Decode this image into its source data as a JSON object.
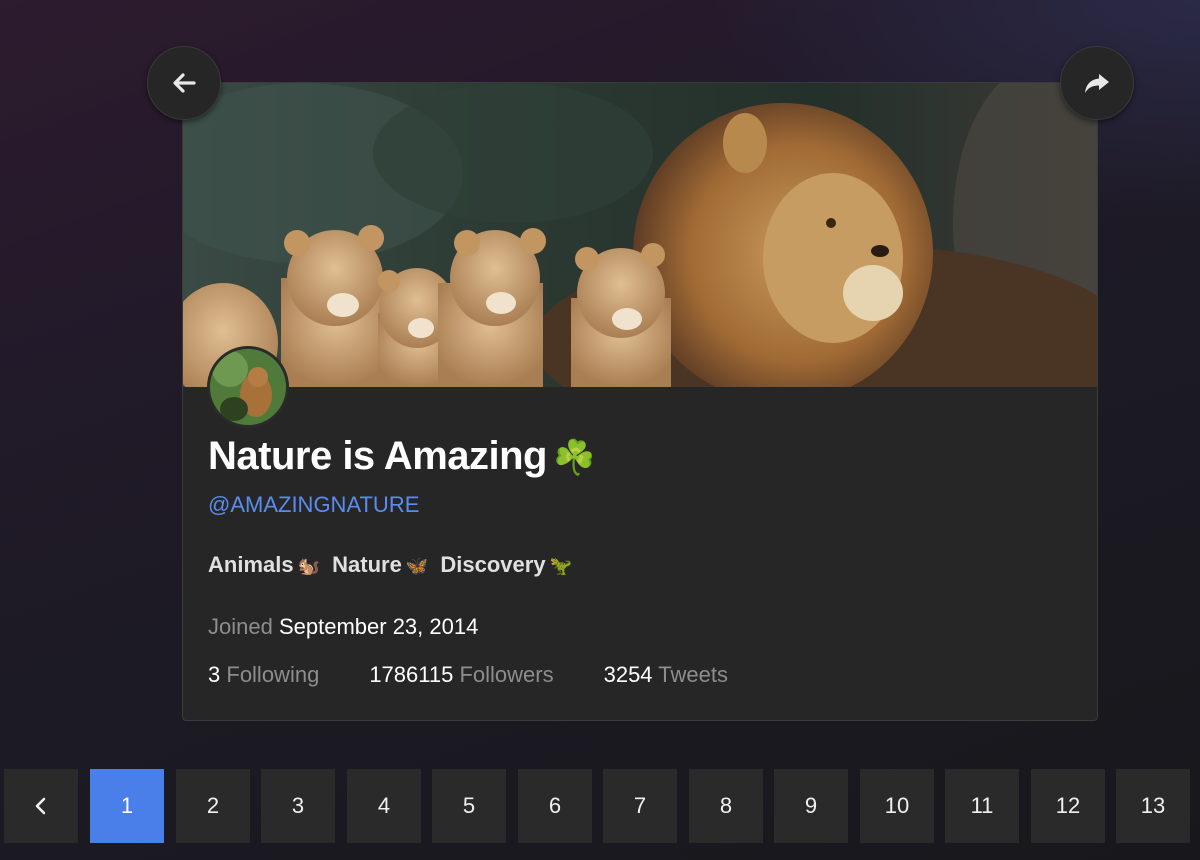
{
  "profile": {
    "name": "Nature is Amazing",
    "name_emoji": "☘️",
    "handle": "@AMAZINGNATURE",
    "bio": [
      {
        "text": "Animals",
        "emoji": "🐿️"
      },
      {
        "text": "Nature",
        "emoji": "🦋"
      },
      {
        "text": "Discovery",
        "emoji": "🦖"
      }
    ],
    "joined_label": "Joined",
    "joined_date": "September 23, 2014",
    "following_count": "3",
    "following_label": "Following",
    "followers_count": "1786115",
    "followers_label": "Followers",
    "tweets_count": "3254",
    "tweets_label": "Tweets"
  },
  "navigation": {
    "back_icon": "arrow-left-icon",
    "share_icon": "share-icon"
  },
  "pagination": {
    "prev_label": "‹",
    "pages": [
      "1",
      "2",
      "3",
      "4",
      "5",
      "6",
      "7",
      "8",
      "9",
      "10",
      "11",
      "12",
      "13"
    ],
    "active_page": "1"
  },
  "colors": {
    "accent": "#4a7ee8",
    "handle": "#5a8cf0",
    "card_bg": "#262626"
  }
}
